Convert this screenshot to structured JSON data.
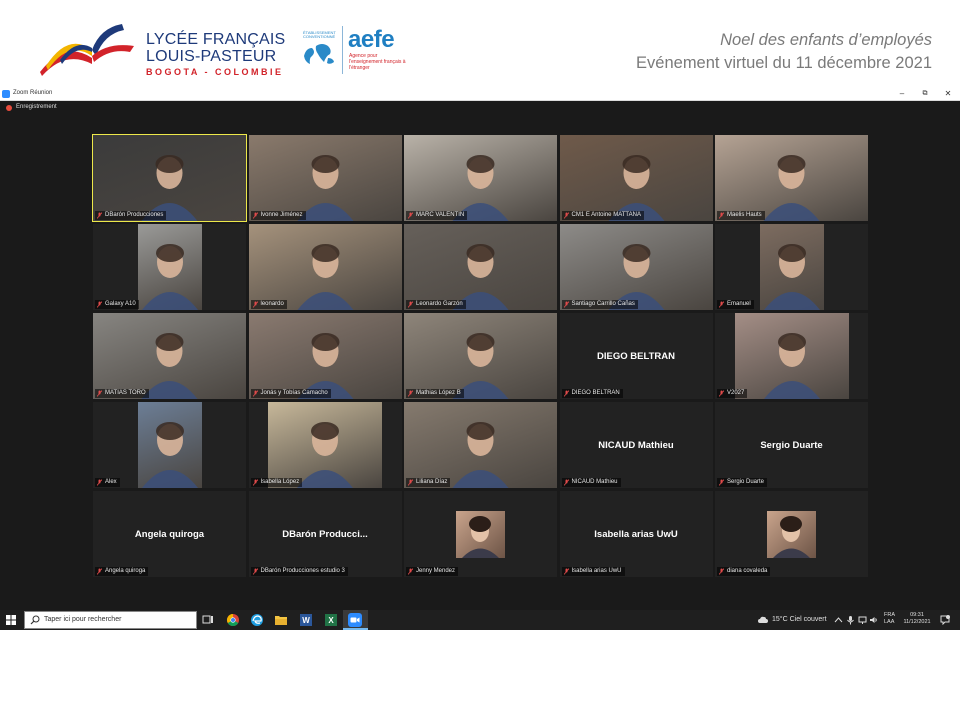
{
  "header": {
    "school_line1": "LYCÉE FRANÇAIS",
    "school_line2": "LOUIS-PASTEUR",
    "school_city": "BOGOTA - COLOMBIE",
    "aefe_small": "ÉTABLISSEMENT CONVENTIONNÉ",
    "aefe_word": "aefe",
    "aefe_sub": "Agence pour l'enseignement français à l'étranger",
    "event_line1": "Noel des enfants d’employés",
    "event_line2": "Evénement virtuel du 11 décembre 2021"
  },
  "window": {
    "title": "Zoom Réunion",
    "minimize": "–",
    "maximize": "⧉",
    "close": "✕",
    "recording": "Enregistrement"
  },
  "tiles": [
    {
      "name": "DBarón Producciones",
      "display": "",
      "bg": "#3b3b3b"
    },
    {
      "name": "Ivonne Jiménez",
      "display": "",
      "bg": "#8a7a6c"
    },
    {
      "name": "MARC VALENTIN",
      "display": "",
      "bg": "#b9b2a8"
    },
    {
      "name": "CM1 E Antoine MATTANA",
      "display": "",
      "bg": "#6f5a4a"
    },
    {
      "name": "Maelis Hauts",
      "display": "",
      "bg": "#b5a394"
    },
    {
      "name": "Galaxy A10",
      "display": "",
      "bg": "#9a9a98"
    },
    {
      "name": "leonardo",
      "display": "",
      "bg": "#a5927c"
    },
    {
      "name": "Leonardo Garzón",
      "display": "",
      "bg": "#66605a"
    },
    {
      "name": "Santiago Carrillo Cañas",
      "display": "",
      "bg": "#8d8b88"
    },
    {
      "name": "Emanuel",
      "display": "",
      "bg": "#7d6c60"
    },
    {
      "name": "MATIAS TORO",
      "display": "",
      "bg": "#878581"
    },
    {
      "name": "Jonás y Tobías Camacho",
      "display": "",
      "bg": "#8a7a70"
    },
    {
      "name": "Mathias López B",
      "display": "",
      "bg": "#8e857a"
    },
    {
      "name": "DIEGO BELTRAN",
      "display": "DIEGO BELTRAN",
      "bg": "#222222"
    },
    {
      "name": "V2027",
      "display": "",
      "bg": "#a48e86"
    },
    {
      "name": "Alex",
      "display": "",
      "bg": "#6c7e96"
    },
    {
      "name": "Isabella  López",
      "display": "",
      "bg": "#c7b89a"
    },
    {
      "name": "Liliana Díaz",
      "display": "",
      "bg": "#857a6e"
    },
    {
      "name": "NICAUD Mathieu",
      "display": "NICAUD Mathieu",
      "bg": "#222222"
    },
    {
      "name": "Sergio Duarte",
      "display": "Sergio Duarte",
      "bg": "#222222"
    },
    {
      "name": "Angela quiroga",
      "display": "Angela quiroga",
      "bg": "#222222"
    },
    {
      "name": "DBarón Producciones estudio 3",
      "display": "DBarón  Producci...",
      "bg": "#222222"
    },
    {
      "name": "Jenny Mendez",
      "display": "",
      "bg": "#222222"
    },
    {
      "name": "Isabella arias UwU",
      "display": "Isabella arias UwU",
      "bg": "#222222"
    },
    {
      "name": "diana covaleda",
      "display": "",
      "bg": "#222222"
    }
  ],
  "taskbar": {
    "search_placeholder": "Taper ici pour rechercher",
    "weather": "15°C  Ciel couvert",
    "lang_line1": "FRA",
    "lang_line2": "LAA",
    "time": "09:31",
    "date": "11/12/2021"
  },
  "colors": {
    "active_speaker": "#ede84a",
    "zoom_blue": "#2d8cff",
    "meeting_bg": "#1a1a1a",
    "tile_bg": "#222222",
    "school_blue": "#1e3a7a",
    "school_red": "#d2232a",
    "aefe_blue": "#1f7fc2"
  }
}
